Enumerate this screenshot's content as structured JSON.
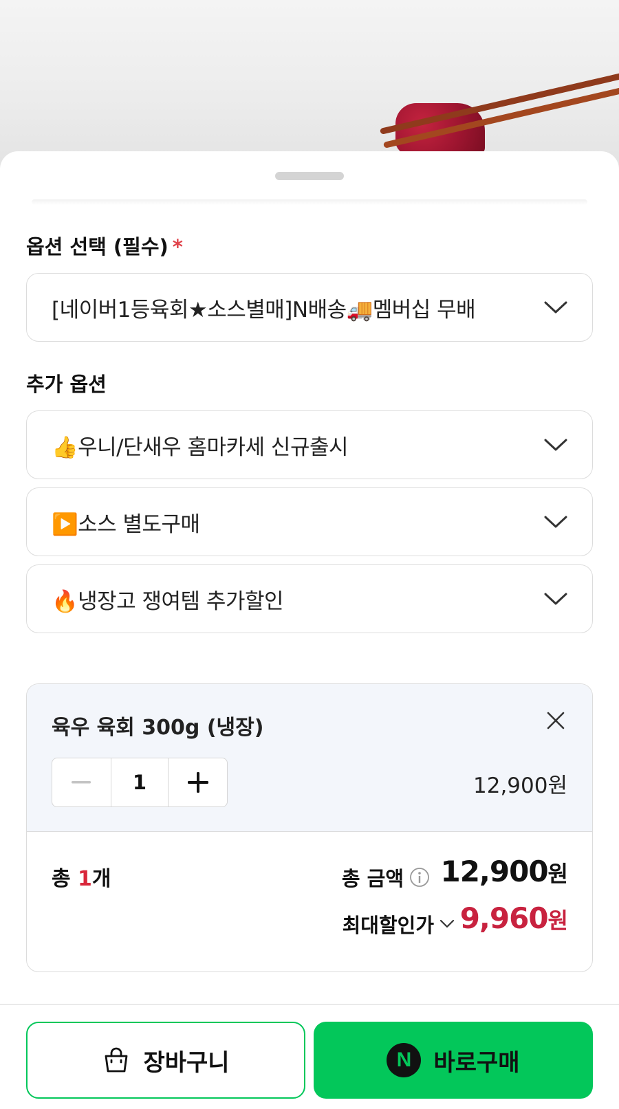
{
  "option_section": {
    "label": "옵션 선택 (필수)",
    "required_mark": "*",
    "selected": "[네이버1등육회★소스별매]N배송🚚멤버십 무배"
  },
  "addon_section": {
    "label": "추가 옵션",
    "options": [
      "👍우니/단새우 홈마카세 신규출시",
      "▶️소스 별도구매",
      "🔥냉장고 쟁여템 추가할인"
    ]
  },
  "selected_item": {
    "name": "육우 육회 300g (냉장)",
    "quantity": "1",
    "price": "12,900원"
  },
  "totals": {
    "count_prefix": "총 ",
    "count": "1",
    "count_suffix": "개",
    "total_label": "총 금액",
    "total_amount": "12,900",
    "total_won": "원",
    "discount_label": "최대할인가",
    "discount_amount": "9,960",
    "discount_won": "원"
  },
  "actions": {
    "cart_label": "장바구니",
    "buy_label": "바로구매",
    "buy_badge": "N"
  },
  "colors": {
    "accent_green": "#03c75a",
    "price_red": "#c8223f",
    "required_red": "#e0434b"
  }
}
